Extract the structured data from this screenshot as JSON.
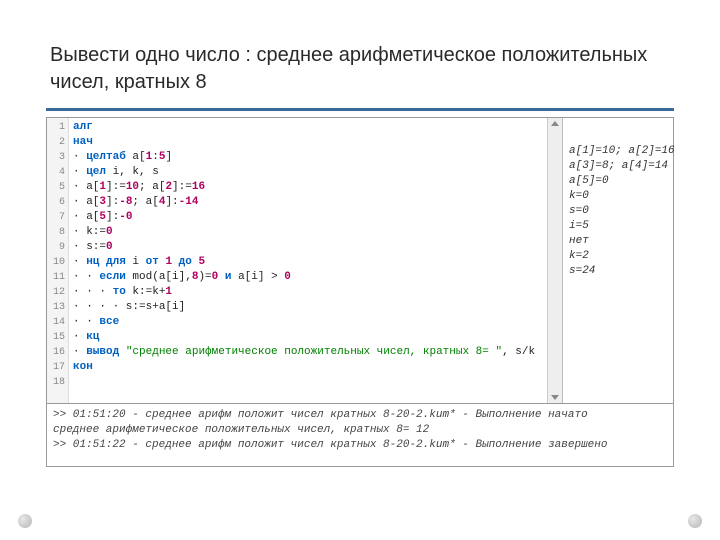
{
  "title": "Вывести одно число : среднее арифметическое положительных чисел, кратных 8",
  "gutter": [
    "1",
    "2",
    "3",
    "4",
    "5",
    "6",
    "7",
    "8",
    "9",
    "10",
    "11",
    "12",
    "13",
    "14",
    "15",
    "16",
    "17",
    "18"
  ],
  "code": {
    "l1": "алг",
    "l2": "нач",
    "l3a": "· ",
    "l3b": "целтаб",
    "l3c": " a[",
    "l3d": "1",
    "l3e": ":",
    "l3f": "5",
    "l3g": "]",
    "l4a": "· ",
    "l4b": "цел",
    "l4c": " i, k, s",
    "l5a": "· a[",
    "l5b": "1",
    "l5c": "]:=",
    "l5d": "10",
    "l5e": "; a[",
    "l5f": "2",
    "l5g": "]:=",
    "l5h": "16",
    "l6a": "· a[",
    "l6b": "3",
    "l6c": "]:",
    "l6d": "-8",
    "l6e": "; a[",
    "l6f": "4",
    "l6g": "]:",
    "l6h": "-14",
    "l7a": "· a[",
    "l7b": "5",
    "l7c": "]:",
    "l7d": "-0",
    "l8a": "· k:=",
    "l8b": "0",
    "l9a": "· s:=",
    "l9b": "0",
    "l10a": "· ",
    "l10b": "нц для",
    "l10c": " i ",
    "l10d": "от",
    "l10e": " ",
    "l10f": "1",
    "l10g": " ",
    "l10h": "до",
    "l10i": " ",
    "l10j": "5",
    "l11a": "· · ",
    "l11b": "если",
    "l11c": " mod(a[i],",
    "l11d": "8",
    "l11e": ")=",
    "l11f": "0",
    "l11g": " ",
    "l11h": "и",
    "l11i": " a[i] > ",
    "l11j": "0",
    "l12a": "· · · ",
    "l12b": "то",
    "l12c": " k:=k+",
    "l12d": "1",
    "l13a": "· · · · s:=s+a[i]",
    "l14a": "· · ",
    "l14b": "все",
    "l15a": "· ",
    "l15b": "кц",
    "l16a": "· ",
    "l16b": "вывод",
    "l16c": " ",
    "l16d": "\"среднее арифметическое положительных чисел, кратных 8= \"",
    "l16e": ", s/k",
    "l17": "кон"
  },
  "vars": {
    "v1": "a[1]=10; a[2]=16",
    "v2": "a[3]=8; a[4]=14",
    "v3": "a[5]=0",
    "v4": "k=0",
    "v5": "s=0",
    "v6": "i=5",
    "v7": "нет",
    "v8": "k=2",
    "v9": "s=24"
  },
  "console": {
    "c1": ">> 01:51:20 - среднее арифм положит чисел кратных 8-20-2.kum* - Выполнение начато",
    "c2": "среднее арифметическое положительных чисел, кратных 8= 12",
    "c3": ">> 01:51:22 - среднее арифм положит чисел кратных 8-20-2.kum* - Выполнение завершено"
  }
}
